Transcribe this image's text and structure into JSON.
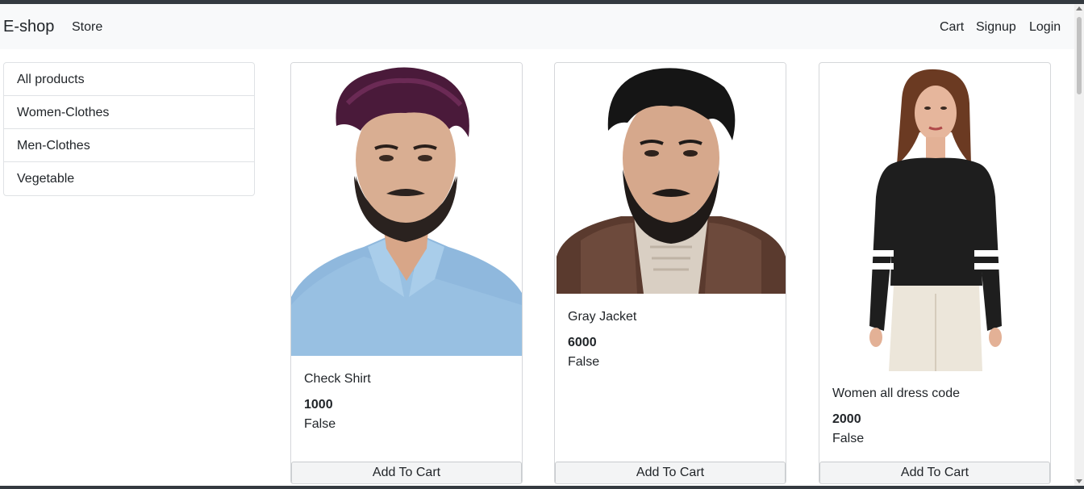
{
  "navbar": {
    "brand": "E-shop",
    "store": "Store",
    "cart": "Cart",
    "signup": "Signup",
    "login": "Login"
  },
  "sidebar": {
    "items": [
      {
        "label": "All products"
      },
      {
        "label": "Women-Clothes"
      },
      {
        "label": "Men-Clothes"
      },
      {
        "label": "Vegetable"
      }
    ]
  },
  "products": [
    {
      "name": "Check Shirt",
      "price": "1000",
      "stock": "False",
      "button": "Add To Cart"
    },
    {
      "name": "Gray Jacket",
      "price": "6000",
      "stock": "False",
      "button": "Add To Cart"
    },
    {
      "name": "Women all dress code",
      "price": "2000",
      "stock": "False",
      "button": "Add To Cart"
    }
  ],
  "colors": {
    "navbar_bg": "#f8f9fa",
    "text": "#212529",
    "border": "#dfe2e5"
  }
}
